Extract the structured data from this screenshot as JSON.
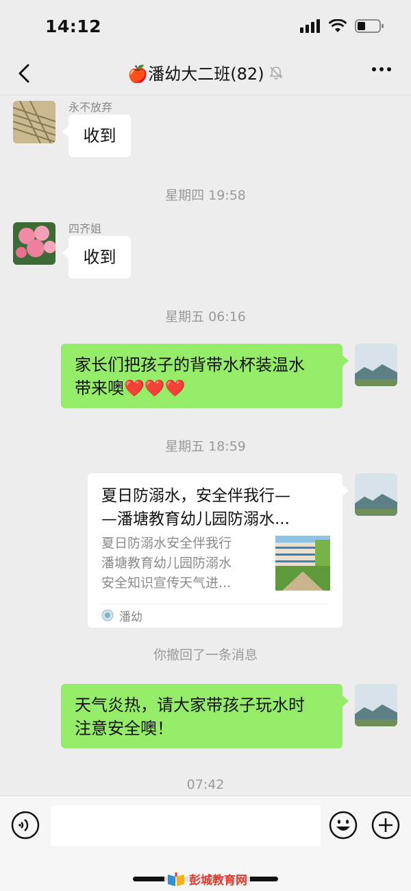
{
  "status_bar": {
    "time": "14:12"
  },
  "header": {
    "title": "🍎潘幼大二班(82)"
  },
  "messages": {
    "m1": {
      "sender": "永不放弃",
      "text": "收到"
    },
    "t1": "星期四 19:58",
    "m2": {
      "sender": "四齐姐",
      "text": "收到"
    },
    "t2": "星期五 06:16",
    "m3": {
      "line1": "家长们把孩子的背带水杯装温水",
      "line2": "带来噢",
      "hearts": "❤️❤️❤️"
    },
    "t3": "星期五 18:59",
    "card": {
      "title_line1": "夏日防溺水，安全伴我行—",
      "title_line2": "—潘塘教育幼儿园防溺水...",
      "desc_line1": "夏日防溺水安全伴我行",
      "desc_line2": "潘塘教育幼儿园防溺水",
      "desc_line3": "安全知识宣传天气进...",
      "source": "潘幼"
    },
    "recall_notice": "你撤回了一条消息",
    "m4": {
      "line1": "天气炎热，请大家带孩子玩水时",
      "line2": "注意安全噢！"
    },
    "t4": "07:42"
  },
  "footer": {
    "watermark": "彭城教育网"
  },
  "colors": {
    "background": "#ededed",
    "bubble_self": "#95ec69",
    "bubble_other": "#ffffff",
    "timestamp": "#9a9a9a"
  },
  "icons": [
    "back-icon",
    "mute-bell-icon",
    "more-icon",
    "voice-icon",
    "emoji-icon",
    "plus-icon"
  ]
}
